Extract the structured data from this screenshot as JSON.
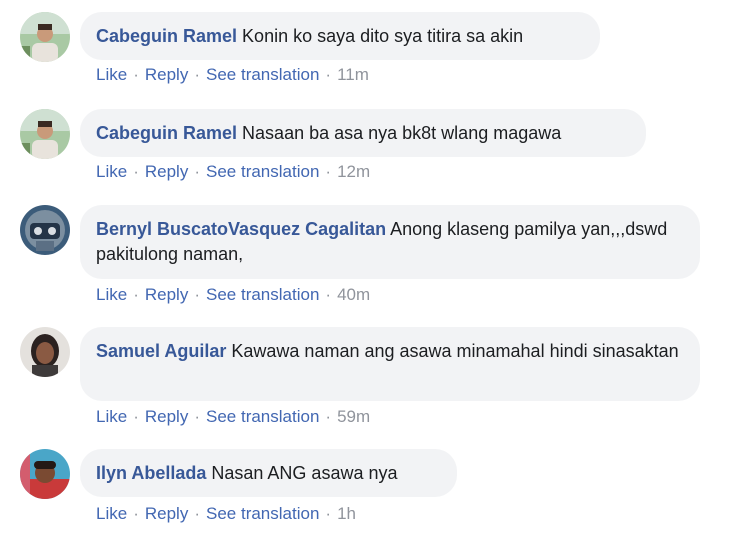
{
  "comments": [
    {
      "author": "Cabeguin Ramel",
      "text": "Konin ko saya dito sya titira sa akin",
      "like": "Like",
      "reply": "Reply",
      "translate": "See translation",
      "time": "11m",
      "avatar_icon": "user-avatar-icon"
    },
    {
      "author": "Cabeguin Ramel",
      "text": "Nasaan ba asa nya bk8t wlang magawa",
      "like": "Like",
      "reply": "Reply",
      "translate": "See translation",
      "time": "12m",
      "avatar_icon": "user-avatar-icon"
    },
    {
      "author": "Bernyl BuscatoVasquez Cagalitan",
      "text": "Anong klaseng pamilya yan,,,dswd pakitulong naman,",
      "like": "Like",
      "reply": "Reply",
      "translate": "See translation",
      "time": "40m",
      "avatar_icon": "user-avatar-icon"
    },
    {
      "author": "Samuel Aguilar",
      "text": "Kawawa naman ang asawa minamahal hindi sinasaktan",
      "like": "Like",
      "reply": "Reply",
      "translate": "See translation",
      "time": "59m",
      "avatar_icon": "user-avatar-icon"
    },
    {
      "author": "Ilyn Abellada",
      "text": "Nasan ANG asawa nya",
      "like": "Like",
      "reply": "Reply",
      "translate": "See translation",
      "time": "1h",
      "avatar_icon": "user-avatar-icon"
    }
  ],
  "colors": {
    "author": "#385898",
    "link": "#4267b2",
    "meta": "#90949c",
    "bubble": "#f2f3f5"
  }
}
